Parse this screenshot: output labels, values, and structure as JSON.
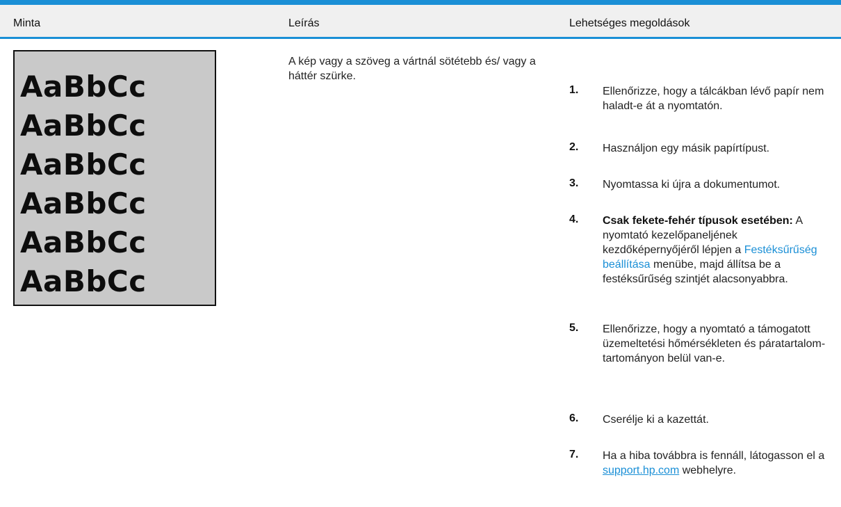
{
  "table": {
    "headers": {
      "sample": "Minta",
      "description": "Leírás",
      "solutions": "Lehetséges megoldások"
    },
    "sample_lines": [
      "AaBbCc",
      "AaBbCc",
      "AaBbCc",
      "AaBbCc",
      "AaBbCc",
      "AaBbCc"
    ],
    "description": "A kép vagy a szöveg a vártnál sötétebb és/ vagy a háttér szürke.",
    "solutions": [
      {
        "num": "1.",
        "text": "Ellenőrizze, hogy a tálcákban lévő papír nem haladt-e át a nyomtatón."
      },
      {
        "num": "2.",
        "text": "Használjon egy másik papírtípust."
      },
      {
        "num": "3.",
        "text": "Nyomtassa ki újra a dokumentumot."
      },
      {
        "num": "4.",
        "bold_prefix": "Csak fekete-fehér típusok esetében:",
        "text_a": " A nyomtató kezelőpaneljének kezdőképernyőjéről lépjen a ",
        "link": "Festéksűrűség beállítása",
        "text_b": " menübe, majd állítsa be a festéksűrűség szintjét alacsonyabbra."
      },
      {
        "num": "5.",
        "text": "Ellenőrizze, hogy a nyomtató a támogatott üzemeltetési hőmérsékleten és páratartalom-tartományon belül van-e."
      },
      {
        "num": "6.",
        "text": "Cserélje ki a kazettát."
      },
      {
        "num": "7.",
        "text_a": "Ha a hiba továbbra is fennáll, látogasson el a ",
        "link": "support.hp.com",
        "text_b": " webhelyre."
      }
    ]
  },
  "colors": {
    "accent": "#1a8fd6",
    "header_bg": "#f0f0f0",
    "sample_bg": "#c9c9c9"
  }
}
